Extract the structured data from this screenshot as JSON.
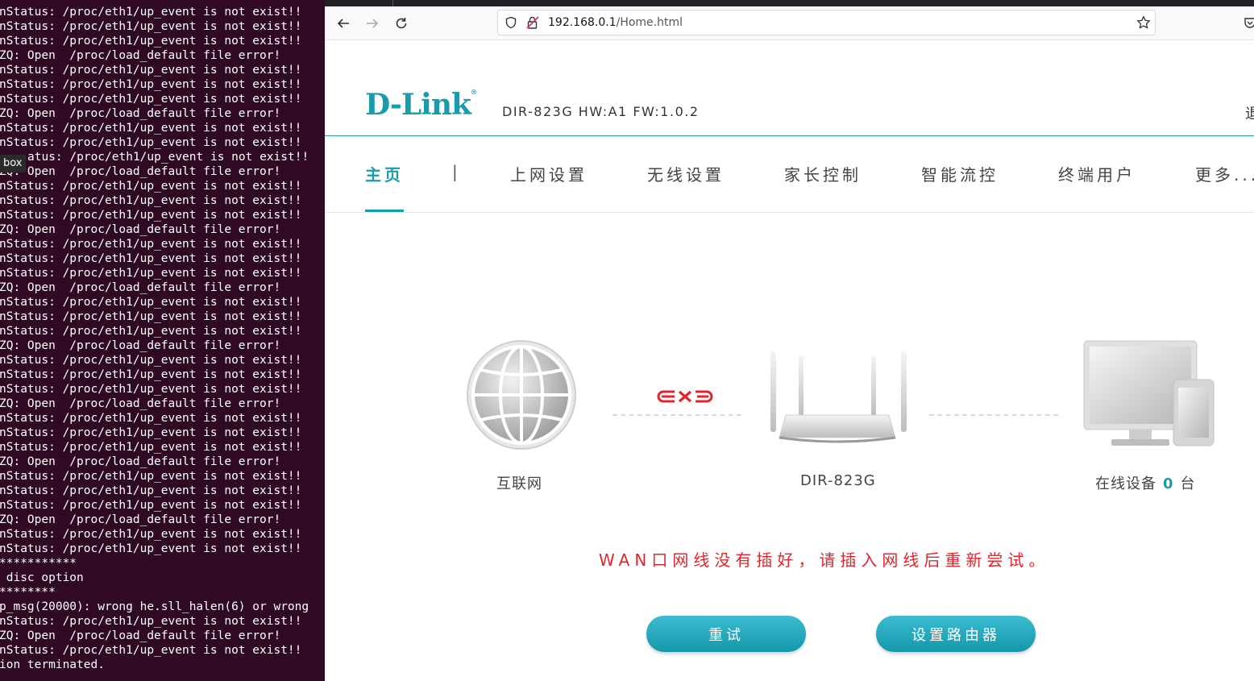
{
  "terminal": {
    "lines": [
      "nStatus: /proc/eth1/up_event is not exist!!",
      "nStatus: /proc/eth1/up_event is not exist!!",
      "nStatus: /proc/eth1/up_event is not exist!!",
      "ZQ: Open  /proc/load_default file error!",
      "nStatus: /proc/eth1/up_event is not exist!!",
      "nStatus: /proc/eth1/up_event is not exist!!",
      "nStatus: /proc/eth1/up_event is not exist!!",
      "ZQ: Open  /proc/load_default file error!",
      "nStatus: /proc/eth1/up_event is not exist!!",
      "nStatus: /proc/eth1/up_event is not exist!!",
      "atus: /proc/eth1/up_event is not exist!!",
      "ZQ: Open  /proc/load_default file error!",
      "nStatus: /proc/eth1/up_event is not exist!!",
      "nStatus: /proc/eth1/up_event is not exist!!",
      "nStatus: /proc/eth1/up_event is not exist!!",
      "ZQ: Open  /proc/load_default file error!",
      "nStatus: /proc/eth1/up_event is not exist!!",
      "nStatus: /proc/eth1/up_event is not exist!!",
      "nStatus: /proc/eth1/up_event is not exist!!",
      "ZQ: Open  /proc/load_default file error!",
      "nStatus: /proc/eth1/up_event is not exist!!",
      "nStatus: /proc/eth1/up_event is not exist!!",
      "nStatus: /proc/eth1/up_event is not exist!!",
      "ZQ: Open  /proc/load_default file error!",
      "nStatus: /proc/eth1/up_event is not exist!!",
      "nStatus: /proc/eth1/up_event is not exist!!",
      "nStatus: /proc/eth1/up_event is not exist!!",
      "ZQ: Open  /proc/load_default file error!",
      "nStatus: /proc/eth1/up_event is not exist!!",
      "nStatus: /proc/eth1/up_event is not exist!!",
      "nStatus: /proc/eth1/up_event is not exist!!",
      "ZQ: Open  /proc/load_default file error!",
      "nStatus: /proc/eth1/up_event is not exist!!",
      "nStatus: /proc/eth1/up_event is not exist!!",
      "nStatus: /proc/eth1/up_event is not exist!!",
      "ZQ: Open  /proc/load_default file error!",
      "nStatus: /proc/eth1/up_event is not exist!!",
      "nStatus: /proc/eth1/up_event is not exist!!",
      "***********",
      " disc option",
      "********",
      "p_msg(20000): wrong he.sll_halen(6) or wrong",
      "nStatus: /proc/eth1/up_event is not exist!!",
      "ZQ: Open  /proc/load_default file error!",
      "nStatus: /proc/eth1/up_event is not exist!!",
      "ion terminated."
    ],
    "tooltip": "box"
  },
  "browser": {
    "url_host": "192.168.0.1",
    "url_path": "/Home.html"
  },
  "page": {
    "logo": "D-Link",
    "model_info": "DIR-823G  HW:A1  FW:1.0.2",
    "exit_label": "退",
    "menu": [
      "主页",
      "上网设置",
      "无线设置",
      "家长控制",
      "智能流控",
      "终端用户",
      "更多..."
    ],
    "menu_separator": "|",
    "internet_label": "互联网",
    "router_label": "DIR-823G",
    "devices_prefix": "在线设备",
    "devices_count": "0",
    "devices_suffix": "台",
    "error_message": "WAN口网线没有插好，请插入网线后重新尝试。",
    "retry_button": "重试",
    "setup_button": "设置路由器"
  }
}
